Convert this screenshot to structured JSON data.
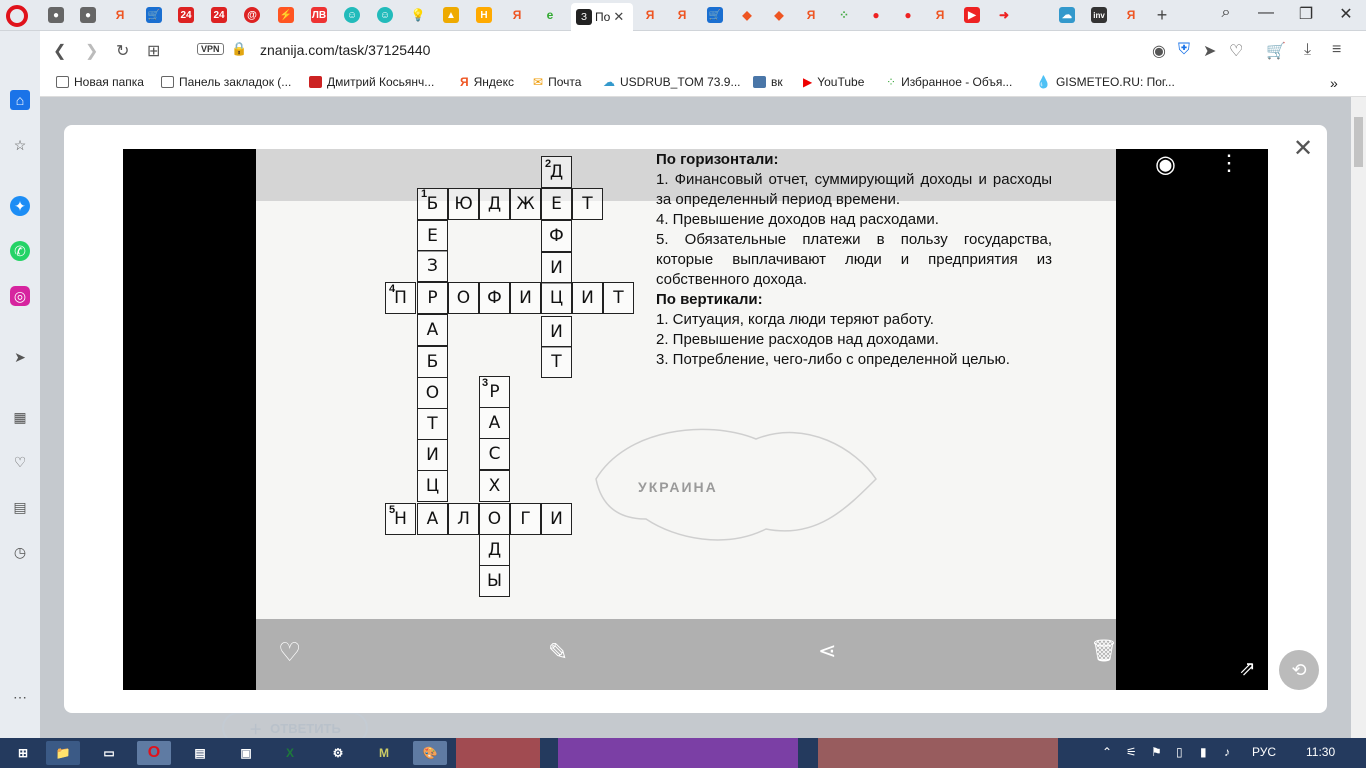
{
  "browser": {
    "active_tab_label": "По",
    "url": "znanija.com/task/37125440",
    "vpn_label": "VPN",
    "bookmarks": [
      "Новая папка",
      "Панель закладок (...",
      "Дмитрий Косьянч...",
      "Яндекс",
      "Почта",
      "USDRUB_TOM 73.9...",
      "вк",
      "YouTube",
      "Избранное - Объя...",
      "GISMETEO.RU: Пог..."
    ]
  },
  "page": {
    "answer_button": "ОТВЕТИТЬ"
  },
  "crossword": {
    "clues_across_title": "По горизонтали:",
    "clues_across": [
      "1. Финансовый отчет, суммирующий доходы и расходы за определенный период времени.",
      "4. Превышение доходов над расходами.",
      "5. Обязательные платежи в пользу государства, которые выплачивают люди и предприятия из собственного дохода."
    ],
    "clues_down_title": "По вертикали:",
    "clues_down": [
      "1. Ситуация, когда люди теряют работу.",
      "2. Превышение расходов над доходами.",
      "3. Потребление, чего-либо с определенной целью."
    ],
    "numbers": [
      "1",
      "2",
      "3",
      "4",
      "5"
    ],
    "map_label": "УКРАИНА"
  },
  "taskbar": {
    "lang": "РУС",
    "time": "11:30"
  }
}
